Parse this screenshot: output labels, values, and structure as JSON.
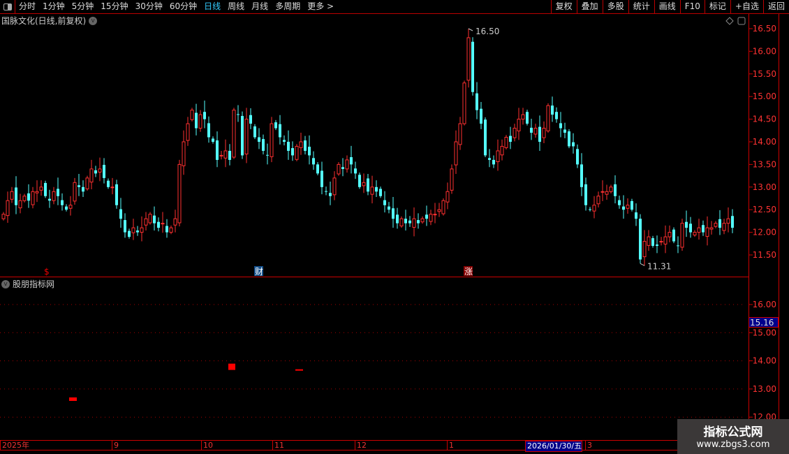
{
  "toolbar": {
    "periods": [
      "分时",
      "1分钟",
      "5分钟",
      "15分钟",
      "30分钟",
      "60分钟",
      "日线",
      "周线",
      "月线",
      "多周期",
      "更多 >"
    ],
    "active_period": "日线",
    "right_buttons": [
      "复权",
      "叠加",
      "多股",
      "统计",
      "画线",
      "F10",
      "标记",
      "+自选",
      "返回"
    ]
  },
  "main": {
    "title": "国脉文化(日线,前复权)",
    "markers": [
      "$",
      "财",
      "涨"
    ],
    "high_label": "16.50",
    "low_label": "11.31"
  },
  "sub": {
    "title": "股朋指标网",
    "price_box": "15.16"
  },
  "time_axis": [
    "2025年",
    "9",
    "10",
    "11",
    "12",
    "1",
    "2026/01/30/五",
    "3"
  ],
  "watermark": {
    "line1": "指标公式网",
    "line2": "www.zbgs3.com"
  },
  "colors": {
    "up": "#ff3030",
    "down": "#54ffff",
    "axis": "#cc0000",
    "text_axis": "#ff3333"
  },
  "chart_data": [
    {
      "type": "candlestick",
      "ylim": [
        11.3,
        16.7
      ],
      "yticks": [
        "16.50",
        "16.00",
        "15.50",
        "15.00",
        "14.50",
        "14.00",
        "13.50",
        "13.00",
        "12.50",
        "12.00",
        "11.50"
      ],
      "closes": [
        12.4,
        12.7,
        12.9,
        12.6,
        12.7,
        12.8,
        12.7,
        12.9,
        12.9,
        13.0,
        12.8,
        12.7,
        12.9,
        12.8,
        12.6,
        12.5,
        12.6,
        13.1,
        13.0,
        12.9,
        13.2,
        13.4,
        13.3,
        13.4,
        13.2,
        13.0,
        13.0,
        12.6,
        12.3,
        12.0,
        11.9,
        12.1,
        12.0,
        12.1,
        12.3,
        12.4,
        12.2,
        12.1,
        12.2,
        12.0,
        12.1,
        12.3,
        13.5,
        14.0,
        14.4,
        14.7,
        14.3,
        14.6,
        14.5,
        14.1,
        14.0,
        13.6,
        13.7,
        13.8,
        13.6,
        14.7,
        14.6,
        13.7,
        14.5,
        14.4,
        14.1,
        14.0,
        13.8,
        13.7,
        14.4,
        14.3,
        14.1,
        14.0,
        13.8,
        13.7,
        13.9,
        14.0,
        13.8,
        13.7,
        13.5,
        13.3,
        13.0,
        12.9,
        12.8,
        13.2,
        13.5,
        13.4,
        13.6,
        13.5,
        13.3,
        13.0,
        13.1,
        12.9,
        13.0,
        12.9,
        12.8,
        12.6,
        12.5,
        12.3,
        12.2,
        12.3,
        12.2,
        12.2,
        12.3,
        12.2,
        12.3,
        12.3,
        12.4,
        12.4,
        12.5,
        12.7,
        12.9,
        13.4,
        14.0,
        14.4,
        15.3,
        16.3,
        15.1,
        14.7,
        14.4,
        13.7,
        13.6,
        13.5,
        13.8,
        13.9,
        14.1,
        14.0,
        14.3,
        14.5,
        14.6,
        14.4,
        14.2,
        14.3,
        14.0,
        14.3,
        14.8,
        14.6,
        14.5,
        14.3,
        14.2,
        13.9,
        13.9,
        13.5,
        13.0,
        12.6,
        12.5,
        12.6,
        12.8,
        12.9,
        12.9,
        13.0,
        12.8,
        12.6,
        12.5,
        12.6,
        12.5,
        12.3,
        11.4,
        11.8,
        11.9,
        11.7,
        11.7,
        11.8,
        11.9,
        12.0,
        11.8,
        11.7,
        12.2,
        12.1,
        12.0,
        12.0,
        12.1,
        12.0,
        12.1,
        12.1,
        12.2,
        12.1,
        12.2,
        12.3,
        12.1
      ],
      "high": 16.5,
      "low": 11.31
    },
    {
      "type": "bar",
      "ylim": [
        12,
        16.9
      ],
      "yticks": [
        "16.00",
        "15.00",
        "14.00",
        "13.00",
        "12.00"
      ],
      "marks": [
        {
          "candle": 16,
          "value": 12.7
        },
        {
          "candle": 54,
          "value": 13.9
        },
        {
          "candle": 70,
          "value": 13.7
        }
      ]
    }
  ]
}
